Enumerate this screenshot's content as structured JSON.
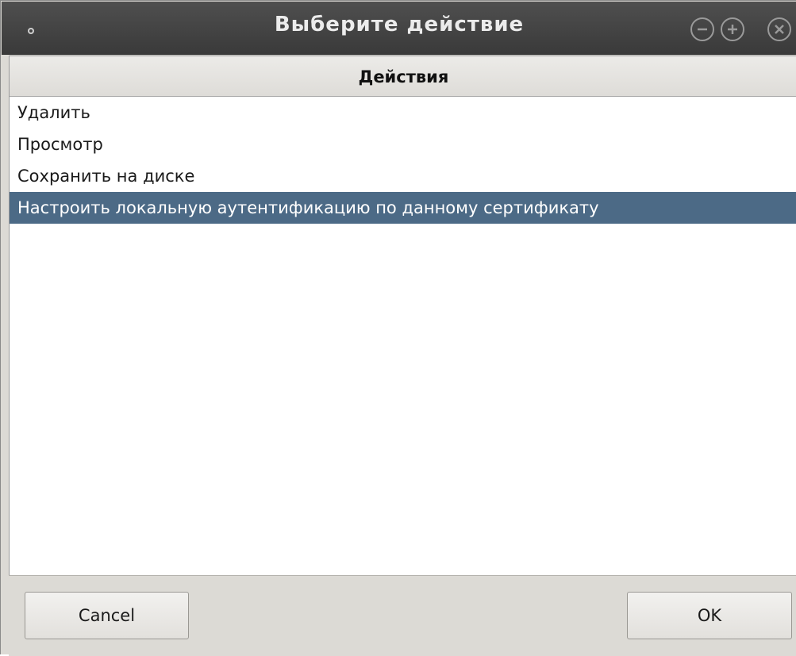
{
  "window": {
    "title": "Выберите действие"
  },
  "list": {
    "header": "Действия",
    "items": [
      {
        "label": "Удалить",
        "selected": false
      },
      {
        "label": "Просмотр",
        "selected": false
      },
      {
        "label": "Сохранить на диске",
        "selected": false
      },
      {
        "label": "Настроить локальную аутентификацию по данному сертификату",
        "selected": true
      }
    ]
  },
  "buttons": {
    "cancel": "Cancel",
    "ok": "OK"
  },
  "icons": {
    "menu": "window-menu-icon",
    "minimize": "minimize-icon",
    "maximize": "maximize-icon",
    "close": "close-icon"
  },
  "colors": {
    "titlebar": "#3a3a3a",
    "selection": "#4c6a86"
  }
}
